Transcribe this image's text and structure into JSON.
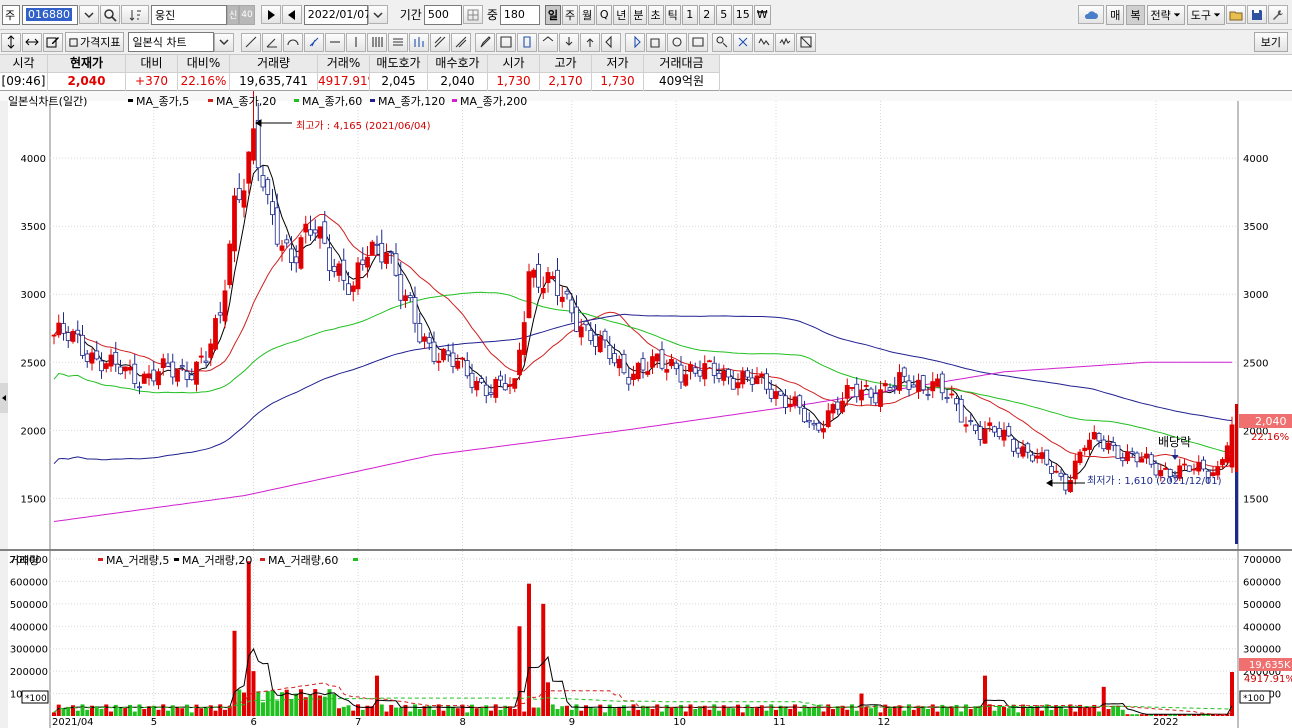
{
  "toolbar": {
    "market_label": "주",
    "code": "016880",
    "stock_name": "웅진",
    "credit_badge": "신",
    "margin_badge": "40",
    "date": "2022/01/07",
    "period_label": "기간",
    "period_value": "500",
    "overlap_label": "중",
    "overlap_value": "180",
    "periods": [
      "일",
      "주",
      "월",
      "Q",
      "년",
      "분",
      "초",
      "틱",
      "1",
      "2",
      "5",
      "15",
      "₩"
    ],
    "right_buttons": [
      "매",
      "복",
      "전략",
      "도구"
    ],
    "indicator_btn": "가격지표",
    "chart_type_select": "일본식 차트",
    "view_btn": "보기"
  },
  "quote": {
    "headers": [
      "시각",
      "현재가",
      "대비",
      "대비%",
      "거래량",
      "거래%",
      "매도호가",
      "매수호가",
      "시가",
      "고가",
      "저가",
      "거래대금"
    ],
    "values": [
      "[09:46]",
      "2,040",
      "+370",
      "22.16%",
      "19,635,741",
      "4917.91%",
      "2,045",
      "2,040",
      "1,730",
      "2,170",
      "1,730",
      "409억원"
    ]
  },
  "colors": {
    "up": "#e00000",
    "down": "#1c2a8c",
    "ma5": "#000000",
    "ma20": "#d02020",
    "ma60": "#20c020",
    "ma120": "#202090",
    "ma200": "#d020d0"
  },
  "price_chart": {
    "title": "일본식차트(일간)",
    "legend": [
      "MA_종가,5",
      "MA_종가,20",
      "MA_종가,60",
      "MA_종가,120",
      "MA_종가,200"
    ],
    "high_note": "최고가 : 4,165 (2021/06/04)",
    "low_note": "최저가 : 1,610 (2021/12/01)",
    "dividend_note": "배당락",
    "current_badge": "2,040",
    "change_badge": "22.16%"
  },
  "volume_chart": {
    "title": "거래량",
    "legend": [
      "MA_거래량,5",
      "MA_거래량,20",
      "MA_거래량,60"
    ],
    "current_badge": "19,635K",
    "ratio_badge": "4917.91%",
    "unit_left": "*100",
    "unit_right": "*100"
  },
  "chart_data": [
    {
      "type": "candlestick",
      "y_ticks": [
        1500,
        2000,
        2500,
        3000,
        3500,
        4000
      ],
      "ylim": [
        1150,
        4420
      ],
      "x_tick_labels": [
        "2021/04",
        "5",
        "6",
        "7",
        "8",
        "9",
        "10",
        "11",
        "12",
        "2022"
      ],
      "close_anchors": [
        [
          0,
          2700
        ],
        [
          5,
          2650
        ],
        [
          12,
          2450
        ],
        [
          20,
          2400
        ],
        [
          28,
          2450
        ],
        [
          32,
          2520
        ],
        [
          35,
          2800
        ],
        [
          38,
          3700
        ],
        [
          42,
          4100
        ],
        [
          45,
          3600
        ],
        [
          50,
          3300
        ],
        [
          55,
          3450
        ],
        [
          60,
          3200
        ],
        [
          63,
          3000
        ],
        [
          66,
          3300
        ],
        [
          70,
          3400
        ],
        [
          73,
          3000
        ],
        [
          77,
          2700
        ],
        [
          82,
          2550
        ],
        [
          87,
          2400
        ],
        [
          92,
          2320
        ],
        [
          97,
          2300
        ],
        [
          100,
          3200
        ],
        [
          103,
          3100
        ],
        [
          106,
          3000
        ],
        [
          110,
          2850
        ],
        [
          115,
          2600
        ],
        [
          120,
          2450
        ],
        [
          125,
          2450
        ],
        [
          130,
          2500
        ],
        [
          135,
          2400
        ],
        [
          140,
          2450
        ],
        [
          145,
          2350
        ],
        [
          150,
          2350
        ],
        [
          155,
          2200
        ],
        [
          160,
          2000
        ],
        [
          163,
          2150
        ],
        [
          170,
          2300
        ],
        [
          175,
          2300
        ],
        [
          180,
          2350
        ],
        [
          185,
          2350
        ],
        [
          190,
          2150
        ],
        [
          195,
          2000
        ],
        [
          200,
          1950
        ],
        [
          205,
          1850
        ],
        [
          210,
          1700
        ],
        [
          213,
          1620
        ],
        [
          217,
          1900
        ],
        [
          222,
          1900
        ],
        [
          227,
          1800
        ],
        [
          232,
          1720
        ],
        [
          240,
          1700
        ],
        [
          245,
          1720
        ],
        [
          248,
          2040
        ]
      ],
      "high_label": 4165,
      "low_label": 1610,
      "last_close": 2040,
      "ma_levels": {
        "ma200": [
          [
            0,
            1330
          ],
          [
            40,
            1520
          ],
          [
            80,
            1820
          ],
          [
            120,
            2000
          ],
          [
            160,
            2200
          ],
          [
            200,
            2430
          ],
          [
            230,
            2500
          ],
          [
            248,
            2500
          ]
        ]
      }
    },
    {
      "type": "bar",
      "y_ticks": [
        100000,
        200000,
        300000,
        400000,
        500000,
        600000,
        700000
      ],
      "ylim": [
        0,
        700000
      ],
      "spikes": [
        [
          38,
          380000
        ],
        [
          41,
          690000
        ],
        [
          42,
          200000
        ],
        [
          68,
          180000
        ],
        [
          98,
          400000
        ],
        [
          100,
          590000
        ],
        [
          103,
          500000
        ],
        [
          104,
          150000
        ],
        [
          170,
          100000
        ],
        [
          196,
          180000
        ],
        [
          221,
          130000
        ],
        [
          232,
          190000
        ],
        [
          248,
          196000
        ]
      ],
      "baseline": 40000
    }
  ]
}
